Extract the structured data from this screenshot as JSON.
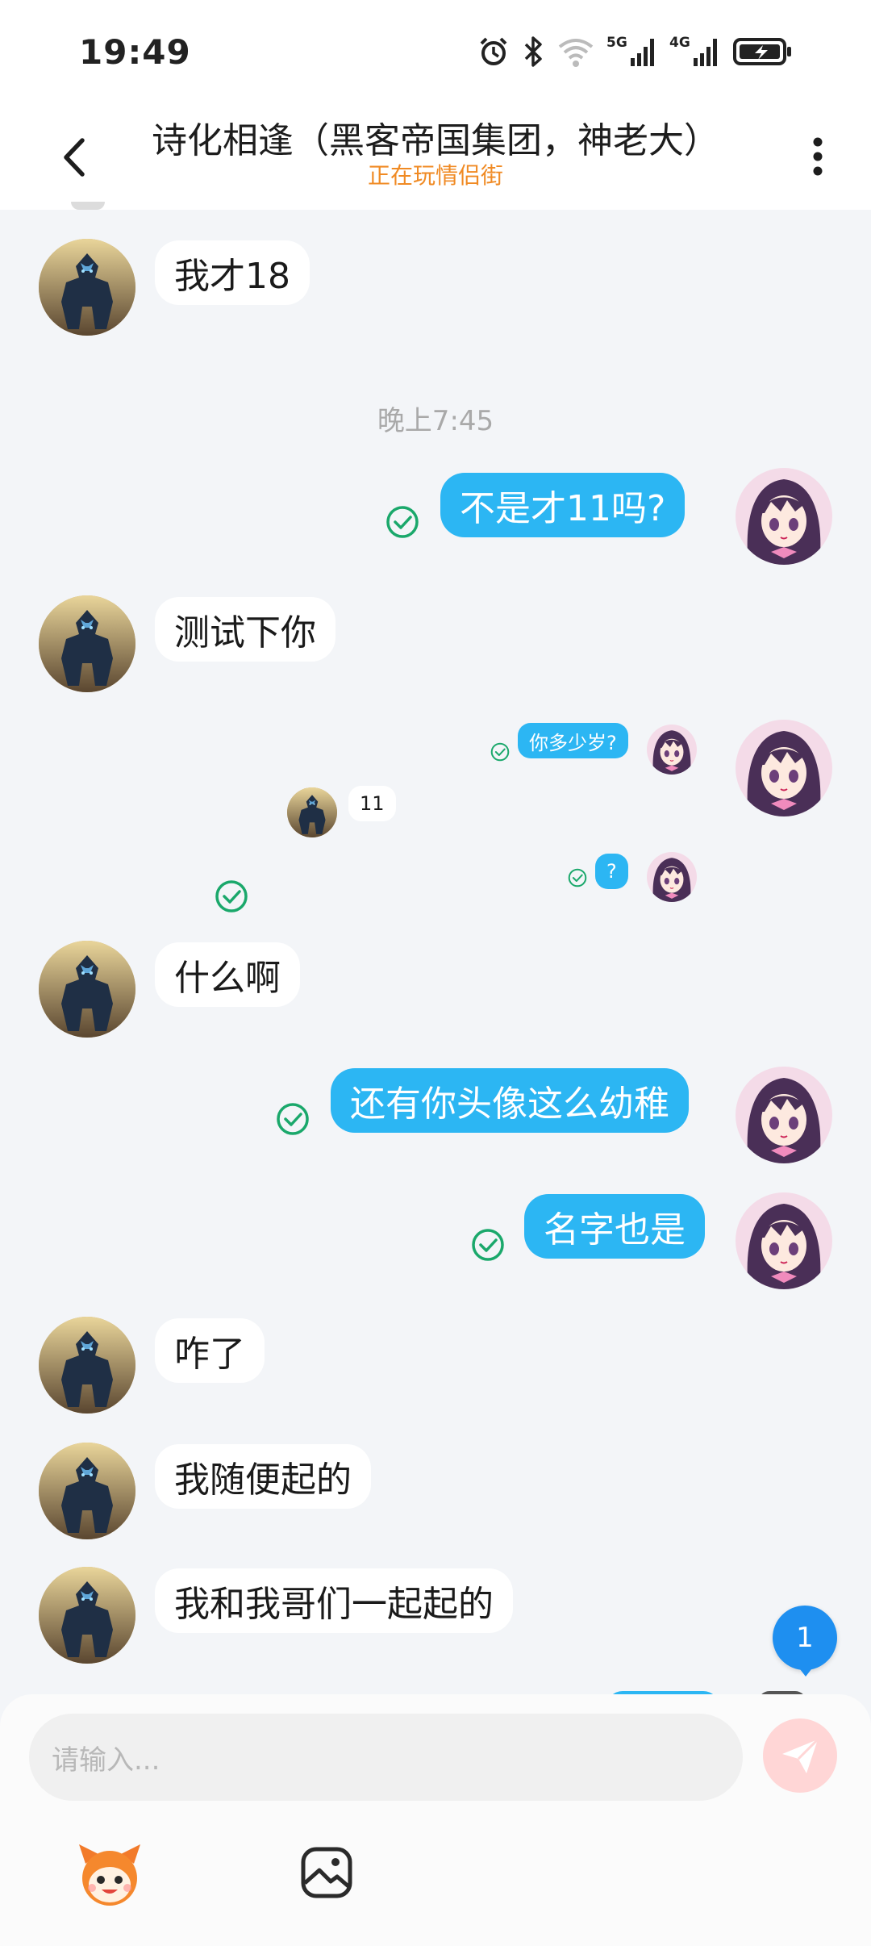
{
  "status_bar": {
    "time": "19:49",
    "net_5g": "5G",
    "net_4g": "4G"
  },
  "header": {
    "title": "诗化相逢（黑客帝国集团，神老大）",
    "subtitle": "正在玩情侣街"
  },
  "chat": {
    "timestamp": "晚上7:45",
    "messages": [
      {
        "from": "other",
        "text": "我才18"
      },
      {
        "from": "me",
        "text": "不是才11吗?"
      },
      {
        "from": "other",
        "text": "测试下你"
      },
      {
        "from": "me",
        "text": "你多少岁?",
        "quoted": true
      },
      {
        "from": "other",
        "text": "11",
        "quoted": true
      },
      {
        "from": "me",
        "text": "?",
        "quoted": true
      },
      {
        "from": "other",
        "text": "什么啊"
      },
      {
        "from": "me",
        "text": "还有你头像这么幼稚"
      },
      {
        "from": "me",
        "text": "名字也是"
      },
      {
        "from": "other",
        "text": "咋了"
      },
      {
        "from": "other",
        "text": "我随便起的"
      },
      {
        "from": "other",
        "text": "我和我哥们一起起的"
      }
    ],
    "unread_badge": "1"
  },
  "input": {
    "placeholder": "请输入..."
  },
  "colors": {
    "accent": "#2cb6f3",
    "subtitle": "#f08a23",
    "read_check": "#1aa86b",
    "badge": "#1e8ff0",
    "background": "#f3f5f8"
  },
  "icons": {
    "back": "chevron-left-icon",
    "more": "more-vertical-icon",
    "send": "send-icon",
    "emoji": "emoji-mascot-icon",
    "image": "image-icon",
    "read": "check-circle-icon"
  }
}
